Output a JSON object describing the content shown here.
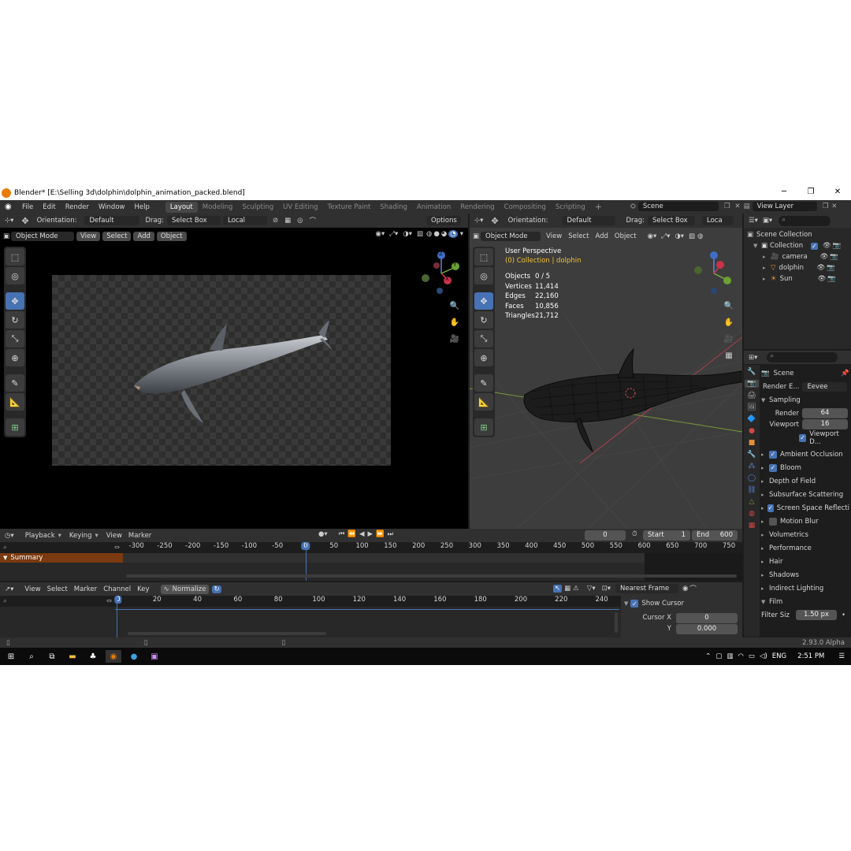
{
  "window": {
    "title": "Blender* [E:\\Selling 3d\\dolphin\\dolphin_animation_packed.blend]",
    "minimize": "─",
    "maximize": "❐",
    "close": "✕"
  },
  "menu": [
    "File",
    "Edit",
    "Render",
    "Window",
    "Help"
  ],
  "workspace_tabs": [
    "Layout",
    "Modeling",
    "Sculpting",
    "UV Editing",
    "Texture Paint",
    "Shading",
    "Animation",
    "Rendering",
    "Compositing",
    "Scripting"
  ],
  "active_tab": "Layout",
  "scene_field": "Scene",
  "view_layer_field": "View Layer",
  "left_viewport": {
    "orientation_label": "Orientation:",
    "orientation_value": "Default",
    "drag_label": "Drag:",
    "drag_value": "Select Box",
    "transform_value": "Local",
    "options_label": "Options",
    "mode": "Object Mode",
    "menus": [
      "View",
      "Select",
      "Add",
      "Object"
    ]
  },
  "right_viewport": {
    "orientation_label": "Orientation:",
    "orientation_value": "Default",
    "drag_label": "Drag:",
    "drag_value": "Select Box",
    "transform_value": "Loca",
    "mode": "Object Mode",
    "menus": [
      "View",
      "Select",
      "Add",
      "Object"
    ],
    "perspective": "User Perspective",
    "collection": "(0) Collection | dolphin",
    "stats": [
      {
        "k": "Objects",
        "v": "0 / 5"
      },
      {
        "k": "Vertices",
        "v": "11,414"
      },
      {
        "k": "Edges",
        "v": "22,160"
      },
      {
        "k": "Faces",
        "v": "10,856"
      },
      {
        "k": "Triangles",
        "v": "21,712"
      }
    ]
  },
  "gizmo": {
    "z": "Z",
    "y": "Y",
    "x": "X"
  },
  "outliner": {
    "root": "Scene Collection",
    "collection": "Collection",
    "items": [
      "camera",
      "dolphin",
      "Sun"
    ]
  },
  "properties": {
    "scene": "Scene",
    "render_engine_label": "Render E...",
    "render_engine": "Eevee",
    "sampling": "Sampling",
    "render_label": "Render",
    "render_value": "64",
    "viewport_label": "Viewport",
    "viewport_value": "16",
    "viewport_denoise": "Viewport D...",
    "panels": [
      {
        "label": "Ambient Occlusion",
        "check": true
      },
      {
        "label": "Bloom",
        "check": true
      },
      {
        "label": "Depth of Field",
        "check": null
      },
      {
        "label": "Subsurface Scattering",
        "check": null
      },
      {
        "label": "Screen Space Reflecti",
        "check": true
      },
      {
        "label": "Motion Blur",
        "check": false
      },
      {
        "label": "Volumetrics",
        "check": null
      },
      {
        "label": "Performance",
        "check": null
      },
      {
        "label": "Hair",
        "check": null
      },
      {
        "label": "Shadows",
        "check": null
      },
      {
        "label": "Indirect Lighting",
        "check": null
      },
      {
        "label": "Film",
        "check": null
      }
    ],
    "filter_label": "Filter Siz",
    "filter_value": "1.50 px",
    "alpha_note": "2.93.0 Alpha"
  },
  "timeline": {
    "menus": [
      "Playback",
      "Keying",
      "View",
      "Marker"
    ],
    "current_frame": "0",
    "start_label": "Start",
    "start_value": "1",
    "end_label": "End",
    "end_value": "600",
    "ticks": [
      "-300",
      "-250",
      "-200",
      "-150",
      "-100",
      "-50",
      "0",
      "50",
      "100",
      "150",
      "200",
      "250",
      "300",
      "350",
      "400",
      "450",
      "500",
      "550",
      "600",
      "650",
      "700",
      "750"
    ],
    "summary": "Summary"
  },
  "graph_editor": {
    "menus": [
      "View",
      "Select",
      "Marker",
      "Channel",
      "Key"
    ],
    "normalize": "Normalize",
    "snap": "Nearest Frame",
    "ticks": [
      "20",
      "40",
      "60",
      "80",
      "100",
      "120",
      "140",
      "160",
      "180",
      "200",
      "220",
      "240"
    ],
    "current": "0",
    "show_cursor": "Show Cursor",
    "cursor_x_label": "Cursor X",
    "cursor_x_value": "0",
    "cursor_y_label": "Y",
    "cursor_y_value": "0.000"
  },
  "taskbar": {
    "lang": "ENG",
    "time": "2:51 PM"
  }
}
